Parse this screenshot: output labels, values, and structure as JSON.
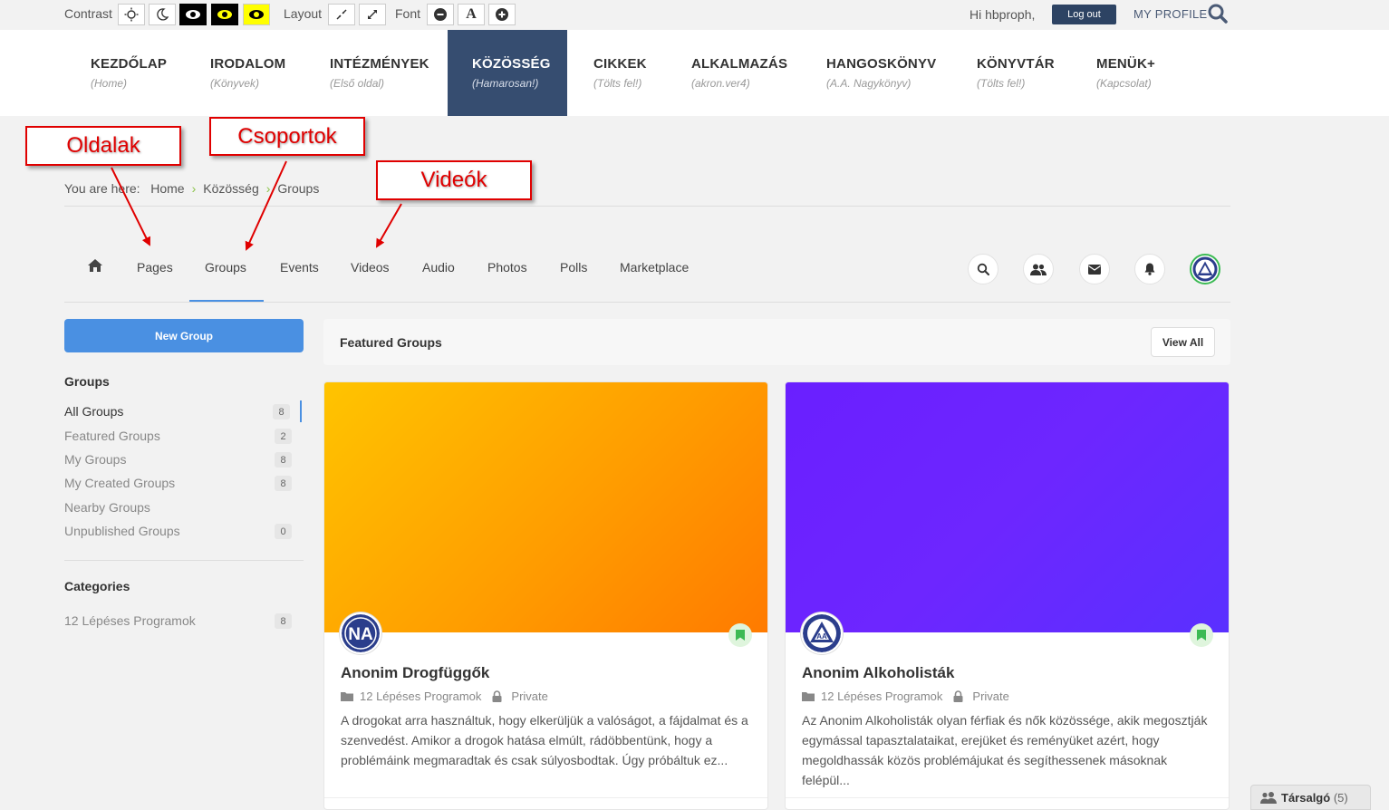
{
  "topbar": {
    "contrast_label": "Contrast",
    "layout_label": "Layout",
    "font_label": "Font",
    "font_letter": "A",
    "greeting": "Hi hbproph,",
    "logout": "Log out",
    "my_profile": "MY PROFILE"
  },
  "nav": [
    {
      "title": "KEZDŐLAP",
      "sub": "(Home)"
    },
    {
      "title": "IRODALOM",
      "sub": "(Könyvek)"
    },
    {
      "title": "INTÉZMÉNYEK",
      "sub": "(Első oldal)"
    },
    {
      "title": "KÖZÖSSÉG",
      "sub": "(Hamarosan!)"
    },
    {
      "title": "CIKKEK",
      "sub": "(Tölts fel!)"
    },
    {
      "title": "ALKALMAZÁS",
      "sub": "(akron.ver4)"
    },
    {
      "title": "HANGOSKÖNYV",
      "sub": "(A.A. Nagykönyv)"
    },
    {
      "title": "KÖNYVTÁR",
      "sub": "(Tölts fel!)"
    },
    {
      "title": "MENÜK+",
      "sub": "(Kapcsolat)"
    }
  ],
  "annotations": {
    "pages": "Oldalak",
    "groups": "Csoportok",
    "videos": "Videók"
  },
  "breadcrumb": {
    "prefix": "You are here:",
    "items": [
      "Home",
      "Közösség",
      "Groups"
    ]
  },
  "subnav": [
    "Pages",
    "Groups",
    "Events",
    "Videos",
    "Audio",
    "Photos",
    "Polls",
    "Marketplace"
  ],
  "sidebar": {
    "new_group": "New Group",
    "groups_heading": "Groups",
    "items": [
      {
        "label": "All Groups",
        "count": "8"
      },
      {
        "label": "Featured Groups",
        "count": "2"
      },
      {
        "label": "My Groups",
        "count": "8"
      },
      {
        "label": "My Created Groups",
        "count": "8"
      },
      {
        "label": "Nearby Groups",
        "count": ""
      },
      {
        "label": "Unpublished Groups",
        "count": "0"
      }
    ],
    "categories_heading": "Categories",
    "categories": [
      {
        "label": "12 Lépéses Programok",
        "count": "8"
      }
    ]
  },
  "featured": {
    "title": "Featured Groups",
    "view_all": "View All"
  },
  "cards": [
    {
      "title": "Anonim Drogfüggők",
      "category": "12 Lépéses Programok",
      "privacy": "Private",
      "desc": "A drogokat arra használtuk, hogy elkerüljük a valóságot, a fájdalmat és a szenvedést. Amikor a drogok hatása elmúlt, rádöbbentünk, hogy a problémáink megmaradtak és csak súlyosbodtak. Úgy próbáltuk ez...",
      "avatar_text": "NA"
    },
    {
      "title": "Anonim Alkoholisták",
      "category": "12 Lépéses Programok",
      "privacy": "Private",
      "desc": "Az Anonim Alkoholisták olyan férfiak és nők közössége, akik megosztják egymással tapasztalataikat, erejüket és reményüket azért, hogy megoldhassák közös problémájukat és segíthessenek másoknak felépül...",
      "avatar_text": "AA"
    }
  ],
  "chat": {
    "label": "Társalgó",
    "count": "(5)"
  },
  "colors": {
    "nav_active": "#364d70",
    "primary": "#4a90e2",
    "annotation": "#e00000"
  }
}
